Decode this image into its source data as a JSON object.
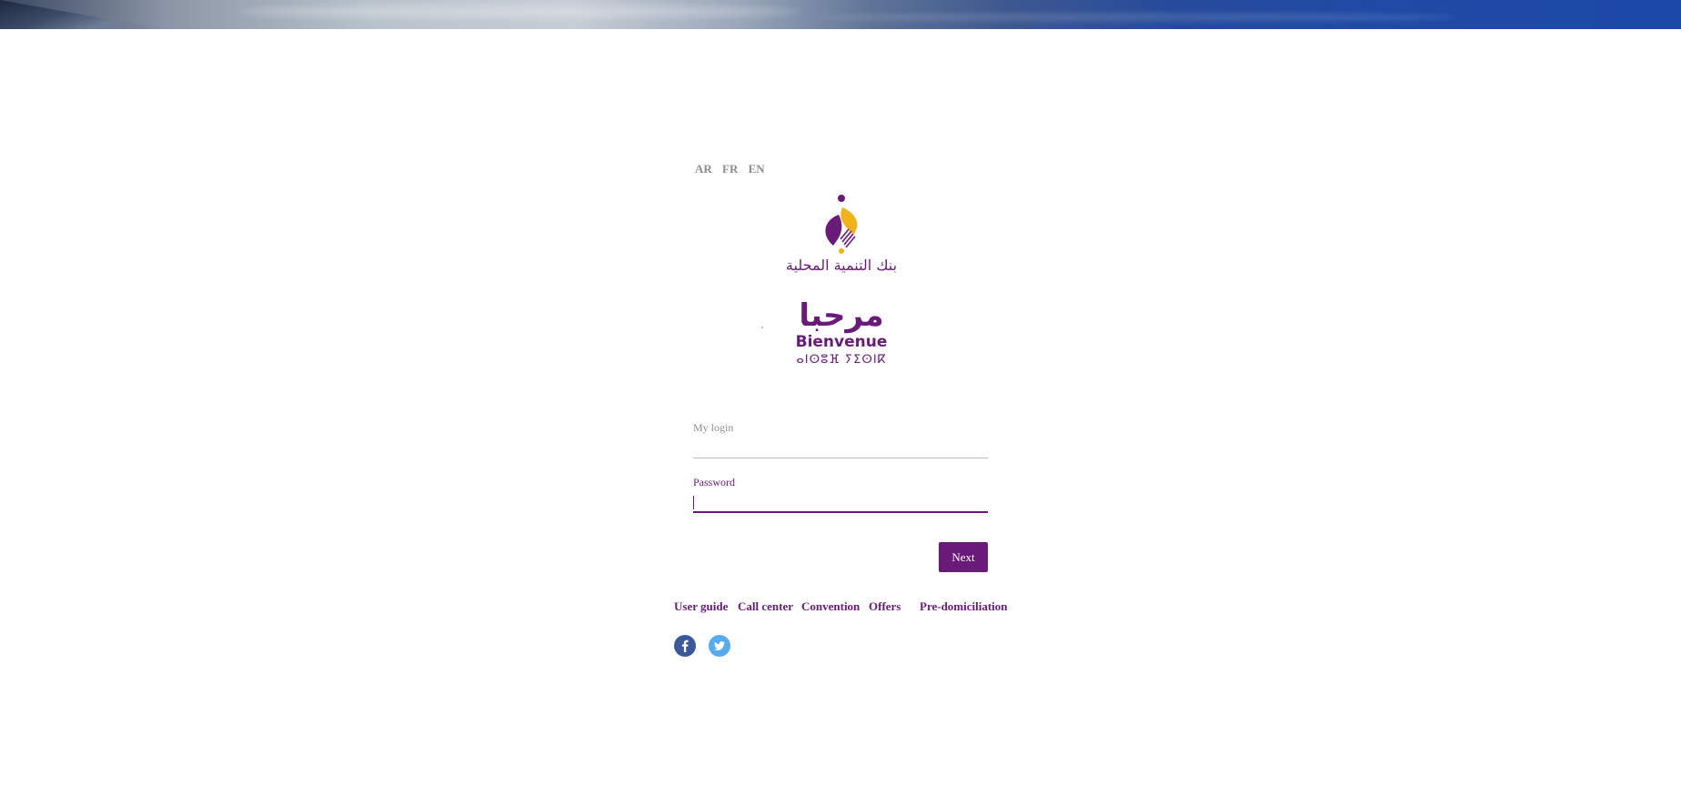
{
  "languages": [
    "AR",
    "FR",
    "EN"
  ],
  "logo": {
    "name_ar": "بنك التنمية المحلية",
    "colors": {
      "purple": "#6a1b7a",
      "gold": "#f2b21a"
    }
  },
  "welcome": {
    "arabic": "مرحبا",
    "french": "Bienvenue",
    "tifinagh": "ⴰⵏⵙⵓⴼ ⵢⵉⵙⵏⴽ"
  },
  "form": {
    "login_label": "My login",
    "login_value": "",
    "password_label": "Password",
    "password_value": "",
    "next_label": "Next"
  },
  "links": [
    "User guide",
    "Call center",
    "Convention",
    "Offers",
    "Pre-domiciliation"
  ],
  "social": {
    "facebook": {
      "icon": "facebook-icon",
      "color": "#3b5998"
    },
    "twitter": {
      "icon": "twitter-icon",
      "color": "#55acee"
    }
  },
  "theme": {
    "accent": "#6a1b7a"
  }
}
